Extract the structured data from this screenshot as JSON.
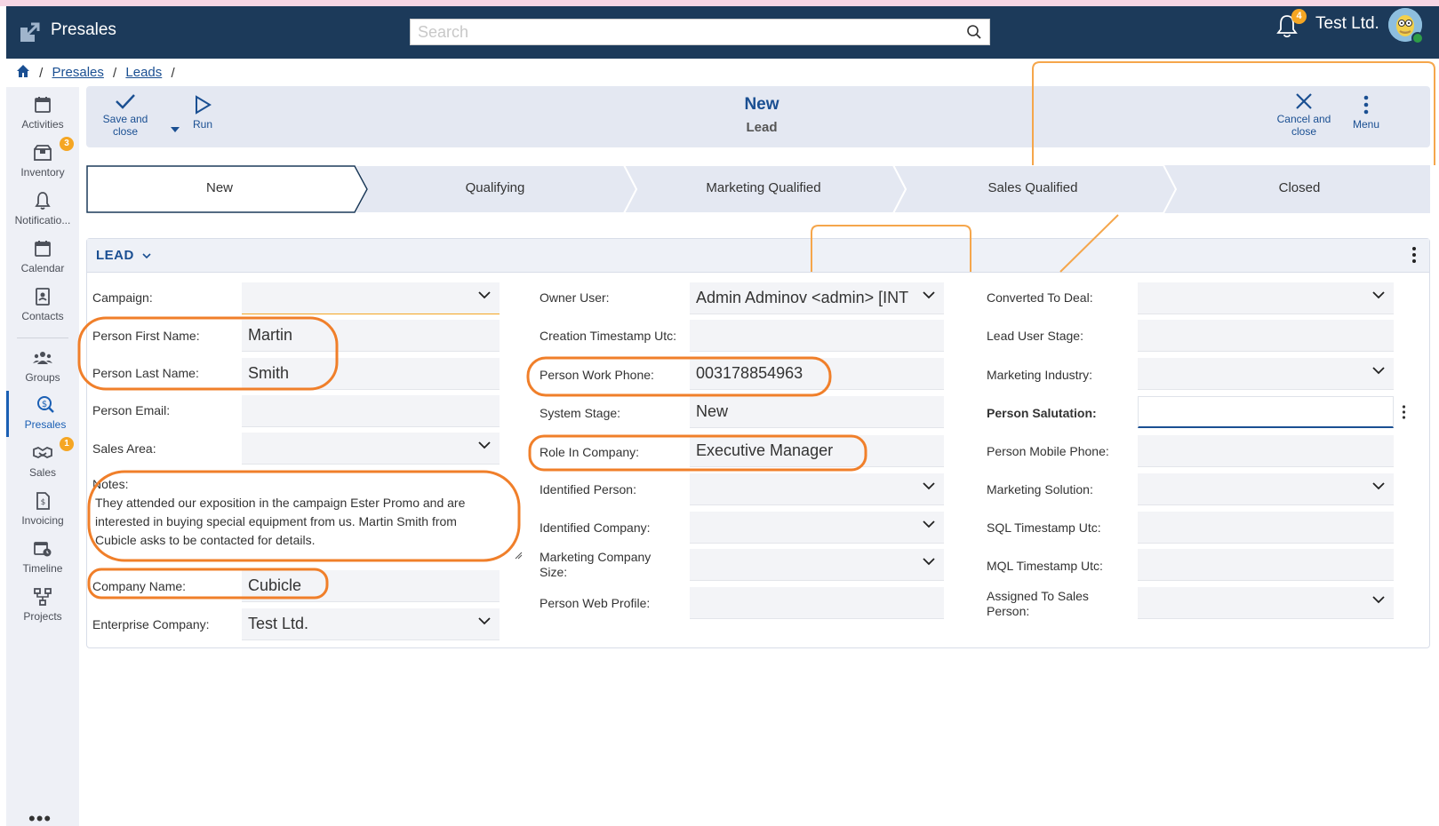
{
  "header": {
    "app_title": "Presales",
    "search_placeholder": "Search",
    "notifications_count": "4",
    "company": "Test Ltd."
  },
  "breadcrumb": {
    "items": [
      "Presales",
      "Leads"
    ],
    "separator": "/"
  },
  "sidenav": {
    "items": [
      {
        "label": "Activities",
        "icon": "calendar-icon"
      },
      {
        "label": "Inventory",
        "icon": "box-icon",
        "badge": "3"
      },
      {
        "label": "Notificatio...",
        "icon": "bell-icon"
      },
      {
        "label": "Calendar",
        "icon": "calendar-icon"
      },
      {
        "label": "Contacts",
        "icon": "contact-card-icon"
      },
      {
        "label": "Groups",
        "icon": "people-icon"
      },
      {
        "label": "Presales",
        "icon": "presales-icon",
        "active": true
      },
      {
        "label": "Sales",
        "icon": "handshake-icon",
        "badge": "1"
      },
      {
        "label": "Invoicing",
        "icon": "invoice-icon"
      },
      {
        "label": "Timeline",
        "icon": "timeline-icon"
      },
      {
        "label": "Projects",
        "icon": "projects-icon"
      }
    ],
    "more": "•••"
  },
  "toolbar": {
    "save_close": "Save and close",
    "run": "Run",
    "title": "New",
    "subtitle": "Lead",
    "cancel_close": "Cancel and close",
    "menu": "Menu"
  },
  "stages": [
    "New",
    "Qualifying",
    "Marketing Qualified",
    "Sales Qualified",
    "Closed"
  ],
  "form": {
    "title": "LEAD",
    "col1": {
      "campaign_label": "Campaign:",
      "first_name_label": "Person First Name:",
      "first_name": "Martin",
      "last_name_label": "Person Last Name:",
      "last_name": "Smith",
      "email_label": "Person Email:",
      "sales_area_label": "Sales Area:",
      "notes_label": "Notes:",
      "notes": "They attended our exposition in the campaign Ester Promo and are interested in buying special equipment from us. Martin Smith from Cubicle asks to be contacted for details.",
      "company_name_label": "Company Name:",
      "company_name": "Cubicle",
      "enterprise_label": "Enterprise Company:",
      "enterprise": "Test Ltd."
    },
    "col2": {
      "owner_label": "Owner User:",
      "owner": "Admin Adminov <admin> [INT",
      "creation_label": "Creation Timestamp Utc:",
      "work_phone_label": "Person Work Phone:",
      "work_phone": "003178854963",
      "system_stage_label": "System Stage:",
      "system_stage": "New",
      "role_label": "Role In Company:",
      "role": "Executive Manager",
      "identified_person_label": "Identified Person:",
      "identified_company_label": "Identified Company:",
      "mkt_company_size_label": "Marketing Company Size:",
      "web_profile_label": "Person Web Profile:"
    },
    "col3": {
      "converted_label": "Converted To Deal:",
      "lead_user_stage_label": "Lead User Stage:",
      "mkt_industry_label": "Marketing Industry:",
      "salutation_label": "Person Salutation:",
      "mobile_label": "Person Mobile Phone:",
      "mkt_solution_label": "Marketing Solution:",
      "sql_label": "SQL Timestamp Utc:",
      "mql_label": "MQL Timestamp Utc:",
      "assigned_label": "Assigned To Sales Person:"
    }
  },
  "colors": {
    "header_bg": "#1c3a5a",
    "accent": "#1a4f92",
    "annotation": "#f07f2a",
    "badge": "#f5a623"
  }
}
